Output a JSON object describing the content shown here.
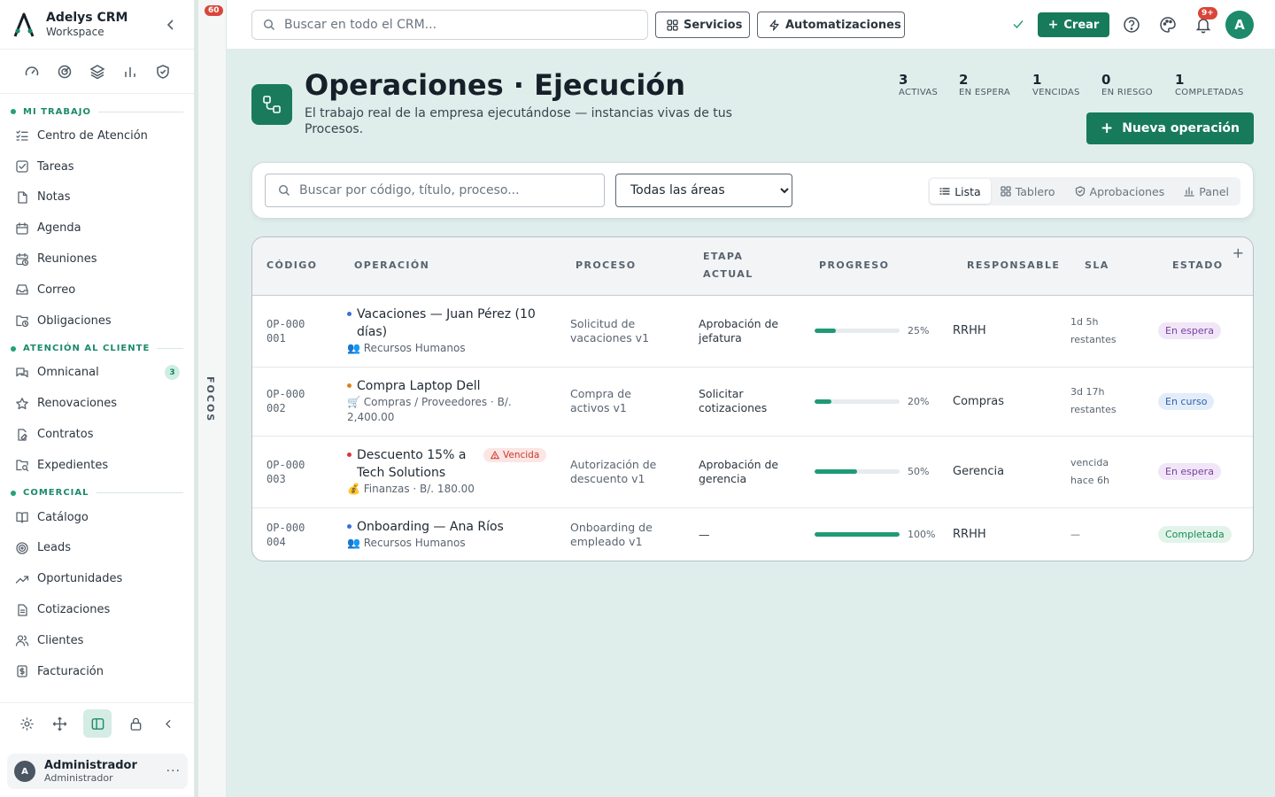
{
  "brand": {
    "title": "Adelys CRM",
    "subtitle": "Workspace"
  },
  "sidebar": {
    "sections": [
      {
        "title": "MI TRABAJO",
        "items": [
          {
            "label": "Centro de Atención",
            "icon": "list-check-icon"
          },
          {
            "label": "Tareas",
            "icon": "checkbox-icon"
          },
          {
            "label": "Notas",
            "icon": "file-icon"
          },
          {
            "label": "Agenda",
            "icon": "calendar-icon"
          },
          {
            "label": "Reuniones",
            "icon": "calendar-clock-icon"
          },
          {
            "label": "Correo",
            "icon": "inbox-icon"
          },
          {
            "label": "Obligaciones",
            "icon": "folder-clock-icon"
          }
        ]
      },
      {
        "title": "ATENCIÓN AL CLIENTE",
        "items": [
          {
            "label": "Omnicanal",
            "icon": "chat-icon",
            "badge": "3"
          },
          {
            "label": "Renovaciones",
            "icon": "star-icon"
          },
          {
            "label": "Contratos",
            "icon": "file-signature-icon"
          },
          {
            "label": "Expedientes",
            "icon": "folder-search-icon"
          }
        ]
      },
      {
        "title": "COMERCIAL",
        "items": [
          {
            "label": "Catálogo",
            "icon": "book-icon"
          },
          {
            "label": "Leads",
            "icon": "target-icon"
          },
          {
            "label": "Oportunidades",
            "icon": "trend-icon"
          },
          {
            "label": "Cotizaciones",
            "icon": "document-icon"
          },
          {
            "label": "Clientes",
            "icon": "users-icon"
          },
          {
            "label": "Facturación",
            "icon": "invoice-icon"
          }
        ]
      }
    ],
    "user": {
      "initial": "A",
      "name": "Administrador",
      "role": "Administrador",
      "more": "···"
    }
  },
  "rail": {
    "count": "60",
    "label": "FOCOS"
  },
  "topbar": {
    "search_placeholder": "Buscar en todo el CRM...",
    "services_label": "Servicios",
    "automations_label": "Automatizaciones",
    "create_label": "Crear",
    "notifications_badge": "9+",
    "avatar_initial": "A"
  },
  "header": {
    "title": "Operaciones · Ejecución",
    "subtitle": "El trabajo real de la empresa ejecutándose — instancias vivas de tus Procesos.",
    "new_button": "Nueva operación",
    "stats": [
      {
        "value": "3",
        "label": "ACTIVAS"
      },
      {
        "value": "2",
        "label": "EN ESPERA"
      },
      {
        "value": "1",
        "label": "VENCIDAS"
      },
      {
        "value": "0",
        "label": "EN RIESGO"
      },
      {
        "value": "1",
        "label": "COMPLETADAS"
      }
    ]
  },
  "filters": {
    "search_placeholder": "Buscar por código, título, proceso...",
    "area_selected": "Todas las áreas",
    "views": [
      {
        "label": "Lista",
        "icon": "list-icon",
        "active": true
      },
      {
        "label": "Tablero",
        "icon": "grid-icon",
        "active": false
      },
      {
        "label": "Aprobaciones",
        "icon": "shield-check-icon",
        "active": false
      },
      {
        "label": "Panel",
        "icon": "bar-chart-icon",
        "active": false
      }
    ]
  },
  "table": {
    "columns": [
      "CÓDIGO",
      "OPERACIÓN",
      "PROCESO",
      "ETAPA ACTUAL",
      "PROGRESO",
      "RESPONSABLE",
      "SLA",
      "ESTADO"
    ],
    "add_column": "+",
    "rows": [
      {
        "code": "OP-000001",
        "title": "Vacaciones — Juan Pérez (10 días)",
        "dot_color": "#3b6fd8",
        "meta": "👥 Recursos Humanos",
        "overdue": "",
        "process": "Solicitud de vacaciones v1",
        "stage": "Aprobación de jefatura",
        "progress": 25,
        "progress_label": "25%",
        "owner": "RRHH",
        "sla": "1d 5h restantes",
        "status": "En espera",
        "status_type": "wait"
      },
      {
        "code": "OP-000002",
        "title": "Compra Laptop Dell",
        "dot_color": "#e0821e",
        "meta": "🛒 Compras / Proveedores · B/. 2,400.00",
        "overdue": "",
        "process": "Compra de activos v1",
        "stage": "Solicitar cotizaciones",
        "progress": 20,
        "progress_label": "20%",
        "owner": "Compras",
        "sla": "3d 17h restantes",
        "status": "En curso",
        "status_type": "run"
      },
      {
        "code": "OP-000003",
        "title": "Descuento 15% a Tech Solutions",
        "dot_color": "#d9363a",
        "meta": "💰 Finanzas · B/. 180.00",
        "overdue": "Vencida",
        "process": "Autorización de descuento v1",
        "stage": "Aprobación de gerencia",
        "progress": 50,
        "progress_label": "50%",
        "owner": "Gerencia",
        "sla": "vencida hace 6h",
        "status": "En espera",
        "status_type": "wait"
      },
      {
        "code": "OP-000004",
        "title": "Onboarding — Ana Ríos",
        "dot_color": "#3b6fd8",
        "meta": "👥 Recursos Humanos",
        "overdue": "",
        "process": "Onboarding de empleado v1",
        "stage": "—",
        "progress": 100,
        "progress_label": "100%",
        "owner": "RRHH",
        "sla": "—",
        "status": "Completada",
        "status_type": "done"
      }
    ]
  }
}
